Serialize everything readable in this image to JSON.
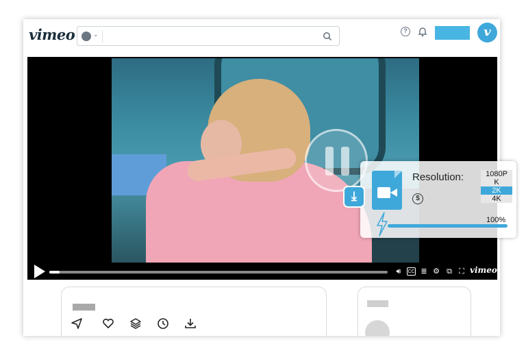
{
  "header": {
    "logo_text": "vimeo",
    "search_placeholder": "",
    "avatar_letter": "v"
  },
  "player": {
    "brand_text": "vimeo",
    "progress_percent": 3
  },
  "downloader": {
    "resolution_label": "Resolution:",
    "options": [
      "1080P",
      "K",
      "2K",
      "4K"
    ],
    "selected_option": "2K",
    "speed_label": "100%",
    "speed_percent": 100
  },
  "colors": {
    "accent": "#3fa8da",
    "join_button": "#48b5e2"
  },
  "icons": [
    "globe-icon",
    "search-icon",
    "help-icon",
    "bell-icon",
    "play-icon",
    "volume-icon",
    "cc-icon",
    "transcript-icon",
    "settings-icon",
    "pip-icon",
    "fullscreen-icon",
    "download-icon",
    "video-file-icon",
    "coin-icon",
    "bolt-icon",
    "share-icon",
    "heart-icon",
    "layers-icon",
    "clock-icon",
    "download-icon"
  ]
}
